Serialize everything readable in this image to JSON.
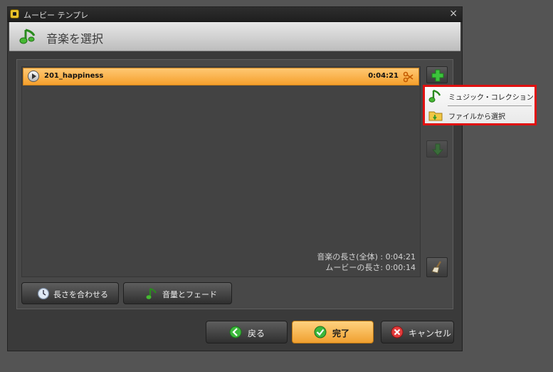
{
  "window": {
    "title": "ムービー テンプレ",
    "close_glyph": "×"
  },
  "header": {
    "title": "音楽を選択",
    "icon": "music-note-icon"
  },
  "tracks": [
    {
      "name": "201_happiness",
      "duration": "0:04:21"
    }
  ],
  "stats": {
    "music_length": "音楽の長さ(全体) : 0:04:21",
    "movie_length": "ムービーの長さ: 0:00:14"
  },
  "side_toolbar": {
    "add_icon": "plus-icon",
    "down_icon": "arrow-down-icon",
    "clear_icon": "broom-icon"
  },
  "bottom_buttons": {
    "fit_length": "長さを合わせる",
    "volume_fade": "音量とフェード"
  },
  "footer": {
    "back": "戻る",
    "finish": "完了",
    "cancel": "キャンセル"
  },
  "popup_menu": {
    "items": [
      {
        "label": "ミュジック・コレクション",
        "icon": "music-note-icon"
      },
      {
        "label": "ファイルから選択",
        "icon": "folder-icon"
      }
    ]
  },
  "colors": {
    "selection": "#f5a02c",
    "accent_green": "#2fa82f",
    "highlight_red": "#e01010"
  }
}
